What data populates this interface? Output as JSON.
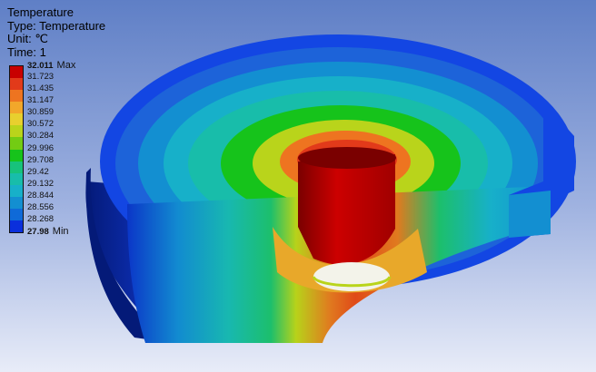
{
  "header": {
    "title": "Temperature",
    "type": "Type: Temperature",
    "unit": "Unit: ℃",
    "time": "Time: 1"
  },
  "legend": {
    "max_tag": "Max",
    "min_tag": "Min",
    "values": [
      "32.011",
      "31.723",
      "31.435",
      "31.147",
      "30.859",
      "30.572",
      "30.284",
      "29.996",
      "29.708",
      "29.42",
      "29.132",
      "28.844",
      "28.556",
      "28.268",
      "27.98"
    ],
    "colors": [
      "#c80000",
      "#e23a1a",
      "#ee7420",
      "#f2a72a",
      "#e8d02e",
      "#b9d41b",
      "#73cc13",
      "#16c31b",
      "#17c27b",
      "#18bdaa",
      "#17b0c9",
      "#138fd1",
      "#0f6ad8",
      "#0a2fdc"
    ]
  },
  "model": {
    "colors": {
      "rim": "#1346e3",
      "rim_dark": "#0b2aa8",
      "outer_band": "#10a6cc",
      "mid_band": "#1ab8b6",
      "green_band": "#1cbf44",
      "yellow_band": "#c2d21a",
      "orange_band": "#e07a1f",
      "hot_core": "#c20000",
      "hole_interior": "#f3f3ea"
    }
  }
}
